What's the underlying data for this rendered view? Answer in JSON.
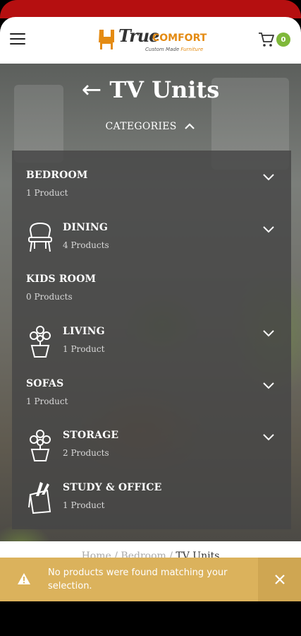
{
  "header": {
    "menu_icon": "hamburger-icon",
    "logo": {
      "true_text": "True",
      "comfort_text": "COMFORT",
      "tagline_a": "Custom Made",
      "tagline_b": "Furniture"
    },
    "cart": {
      "icon": "cart-icon",
      "count": "0"
    }
  },
  "page": {
    "back_icon": "←",
    "title": "TV Units"
  },
  "categories": {
    "toggle_label": "CATEGORIES",
    "items": [
      {
        "name": "BEDROOM",
        "count": "1 Product",
        "icon": "none",
        "expandable": true
      },
      {
        "name": "DINING",
        "count": "4 Products",
        "icon": "dining-chair-icon",
        "expandable": true
      },
      {
        "name": "KIDS ROOM",
        "count": "0 Products",
        "icon": "none",
        "expandable": false
      },
      {
        "name": "LIVING",
        "count": "1 Product",
        "icon": "potted-plant-icon",
        "expandable": true
      },
      {
        "name": "SOFAS",
        "count": "1 Product",
        "icon": "none",
        "expandable": true
      },
      {
        "name": "STORAGE",
        "count": "2 Products",
        "icon": "potted-plant-icon",
        "expandable": true
      },
      {
        "name": "STUDY & OFFICE",
        "count": "1 Product",
        "icon": "pen-holder-icon",
        "expandable": false
      }
    ]
  },
  "breadcrumb": {
    "home": "Home",
    "sep": "/",
    "parent": "Bedroom",
    "current": "TV Units"
  },
  "notice": {
    "text": "No products were found matching your selection.",
    "icon": "warning-icon",
    "close_icon": "close-icon"
  },
  "colors": {
    "status_bar": "#b50f10",
    "badge": "#7fb83a",
    "notice": "#dbb25c",
    "brand_orange": "#e48b13"
  }
}
